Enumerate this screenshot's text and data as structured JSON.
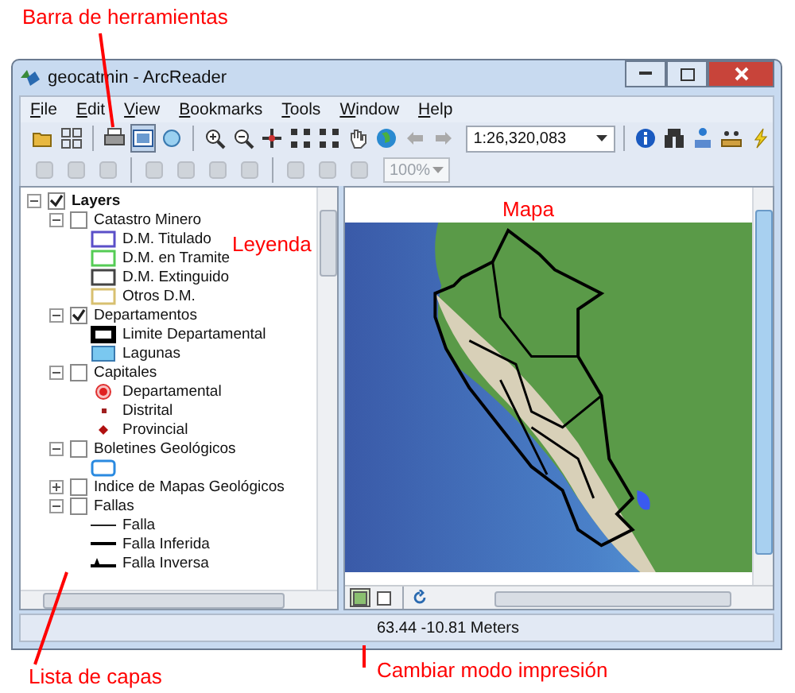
{
  "annotations": [
    {
      "text": "Barra de herramientas"
    },
    {
      "text": "Leyenda"
    },
    {
      "text": "Mapa"
    },
    {
      "text": "Lista de capas"
    },
    {
      "text": "Cambiar modo impresión"
    }
  ],
  "window": {
    "title": "geocatmin - ArcReader"
  },
  "menu": [
    "File",
    "Edit",
    "View",
    "Bookmarks",
    "Tools",
    "Window",
    "Help"
  ],
  "toolbar": {
    "scale": "1:26,320,083"
  },
  "toolbar2": {
    "zoom": "100%",
    "disabled": true
  },
  "layers": [
    {
      "kind": "layer",
      "label": "Layers",
      "checked": true,
      "expanded": true,
      "children": [
        {
          "kind": "layer",
          "label": "Catastro Minero",
          "checked": false,
          "expanded": true,
          "children": [
            {
              "kind": "box",
              "label": "D.M. Titulado",
              "color": "#5a4fc8"
            },
            {
              "kind": "box",
              "label": "D.M. en Tramite",
              "color": "#55cc55"
            },
            {
              "kind": "box",
              "label": "D.M. Extinguido",
              "color": "#444444"
            },
            {
              "kind": "box",
              "label": "Otros D.M.",
              "color": "#d8c070"
            }
          ]
        },
        {
          "kind": "layer",
          "label": "Departamentos",
          "checked": true,
          "expanded": true,
          "children": [
            {
              "kind": "thick-box",
              "label": "Limite Departamental"
            },
            {
              "kind": "filled-box",
              "label": "Lagunas"
            }
          ]
        },
        {
          "kind": "layer",
          "label": "Capitales",
          "checked": false,
          "expanded": true,
          "children": [
            {
              "kind": "dot",
              "label": "Departamental"
            },
            {
              "kind": "small-dot",
              "label": "Distrital"
            },
            {
              "kind": "diamond",
              "label": "Provincial"
            }
          ]
        },
        {
          "kind": "layer",
          "label": "Boletines Geológicos",
          "checked": false,
          "expanded": true,
          "children": [
            {
              "kind": "outline-box"
            }
          ]
        },
        {
          "kind": "layer",
          "label": "Indice de Mapas Geológicos",
          "checked": false,
          "expanded": false
        },
        {
          "kind": "layer",
          "label": "Fallas",
          "checked": false,
          "expanded": true,
          "children": [
            {
              "kind": "line",
              "label": "Falla"
            },
            {
              "kind": "thick-line",
              "label": "Falla Inferida"
            },
            {
              "kind": "thrust-line",
              "label": "Falla Inversa"
            }
          ]
        }
      ]
    }
  ],
  "view_buttons": [
    {
      "selected": true
    },
    {
      "selected": false
    }
  ],
  "status_bar": {
    "coordinates": "63.44  -10.81 Meters"
  }
}
